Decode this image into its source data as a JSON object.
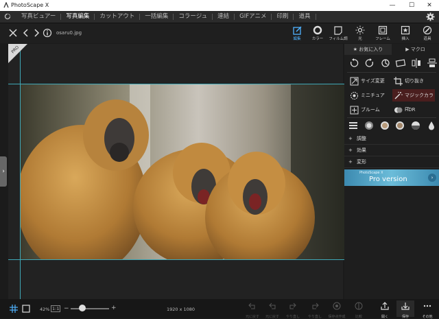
{
  "window": {
    "title": "PhotoScape X",
    "minimize": "—",
    "maximize": "☐",
    "close": "✕"
  },
  "menu": {
    "tabs": [
      "写真ビュアー",
      "写真編集",
      "カットアウト",
      "一括編集",
      "コラージュ",
      "連結",
      "GIFアニメ",
      "印刷",
      "道具"
    ],
    "active_index": 1
  },
  "toolbar": {
    "file_name": "osaru0.jpg",
    "tools": [
      {
        "label": "編集",
        "icon": "edit-icon",
        "active": true
      },
      {
        "label": "カラー",
        "icon": "color-icon",
        "active": false
      },
      {
        "label": "フィルム調",
        "icon": "film-icon",
        "active": false
      },
      {
        "label": "光",
        "icon": "light-icon",
        "active": false
      },
      {
        "label": "フレーム",
        "icon": "frame-icon",
        "active": false
      },
      {
        "label": "挿入",
        "icon": "insert-icon",
        "active": false
      },
      {
        "label": "道具",
        "icon": "tool-icon",
        "active": false
      }
    ]
  },
  "canvas": {
    "badge": "PRO"
  },
  "panel": {
    "tabs": [
      "★ お気に入り",
      "▶ マクロ"
    ],
    "tools": [
      {
        "label": "サイズ変更",
        "icon": "resize-icon"
      },
      {
        "label": "切り抜き",
        "icon": "crop-icon"
      },
      {
        "label": "ミニチュア",
        "icon": "miniature-icon"
      },
      {
        "label": "マジックカラー",
        "icon": "magic-color-icon"
      },
      {
        "label": "ブルーム",
        "icon": "bloom-icon"
      },
      {
        "label": "HDR",
        "icon": "hdr-icon"
      }
    ],
    "sections": [
      "調整",
      "効果",
      "変形"
    ],
    "pro_banner": {
      "small": "PhotoScape X",
      "big": "Pro version"
    }
  },
  "bottom": {
    "zoom": "42%",
    "one_to_one": "1:1",
    "dimensions": "1920 x 1080",
    "actions": [
      {
        "label": "元に戻す",
        "icon": "undo-all-icon",
        "dim": true
      },
      {
        "label": "元に戻す",
        "icon": "undo-icon",
        "dim": true
      },
      {
        "label": "やり直し",
        "icon": "redo-icon",
        "dim": true
      },
      {
        "label": "やり直し",
        "icon": "redo-all-icon",
        "dim": true
      },
      {
        "label": "保存点作成",
        "icon": "savepoint-icon",
        "dim": true
      },
      {
        "label": "比較",
        "icon": "compare-icon",
        "dim": true
      },
      {
        "label": "開く",
        "icon": "open-icon",
        "dim": false
      },
      {
        "label": "保存",
        "icon": "save-icon",
        "dim": false
      },
      {
        "label": "その他",
        "icon": "more-icon",
        "dim": false
      }
    ],
    "zoom_fraction": 0.3
  }
}
